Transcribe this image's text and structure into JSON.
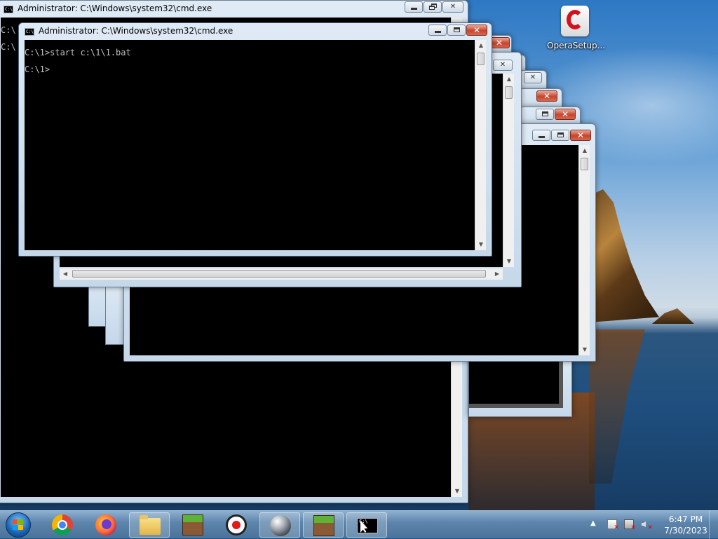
{
  "desktop": {
    "icons": [
      {
        "label": "OperaSetup...",
        "icon": "opera-installer-icon"
      }
    ]
  },
  "windows": {
    "back": {
      "title": "Administrator: C:\\Windows\\system32\\cmd.exe",
      "lines": [
        "C:\\",
        "C:\\"
      ]
    },
    "front": {
      "title": "Administrator: C:\\Windows\\system32\\cmd.exe",
      "lines": [
        "C:\\1>start c:\\1\\1.bat",
        "C:\\1>"
      ]
    }
  },
  "taskbar": {
    "start_icon": "windows-start-orb",
    "pinned": [
      {
        "name": "chrome",
        "icon": "chrome-icon"
      },
      {
        "name": "firefox",
        "icon": "firefox-icon"
      },
      {
        "name": "explorer",
        "icon": "folder-icon"
      },
      {
        "name": "minecraft",
        "icon": "grass-block-icon"
      },
      {
        "name": "recorder",
        "icon": "record-icon"
      },
      {
        "name": "sphere",
        "icon": "sphere-icon"
      },
      {
        "name": "minecraft-2",
        "icon": "grass-block-icon"
      },
      {
        "name": "cmd",
        "icon": "cmd-icon"
      }
    ],
    "tray": {
      "time": "6:47 PM",
      "date": "7/30/2023"
    }
  },
  "colors": {
    "console_bg": "#000000",
    "console_text": "#c0c0c0",
    "close_button": "#c8432d",
    "taskbar": "#5e86ad"
  }
}
